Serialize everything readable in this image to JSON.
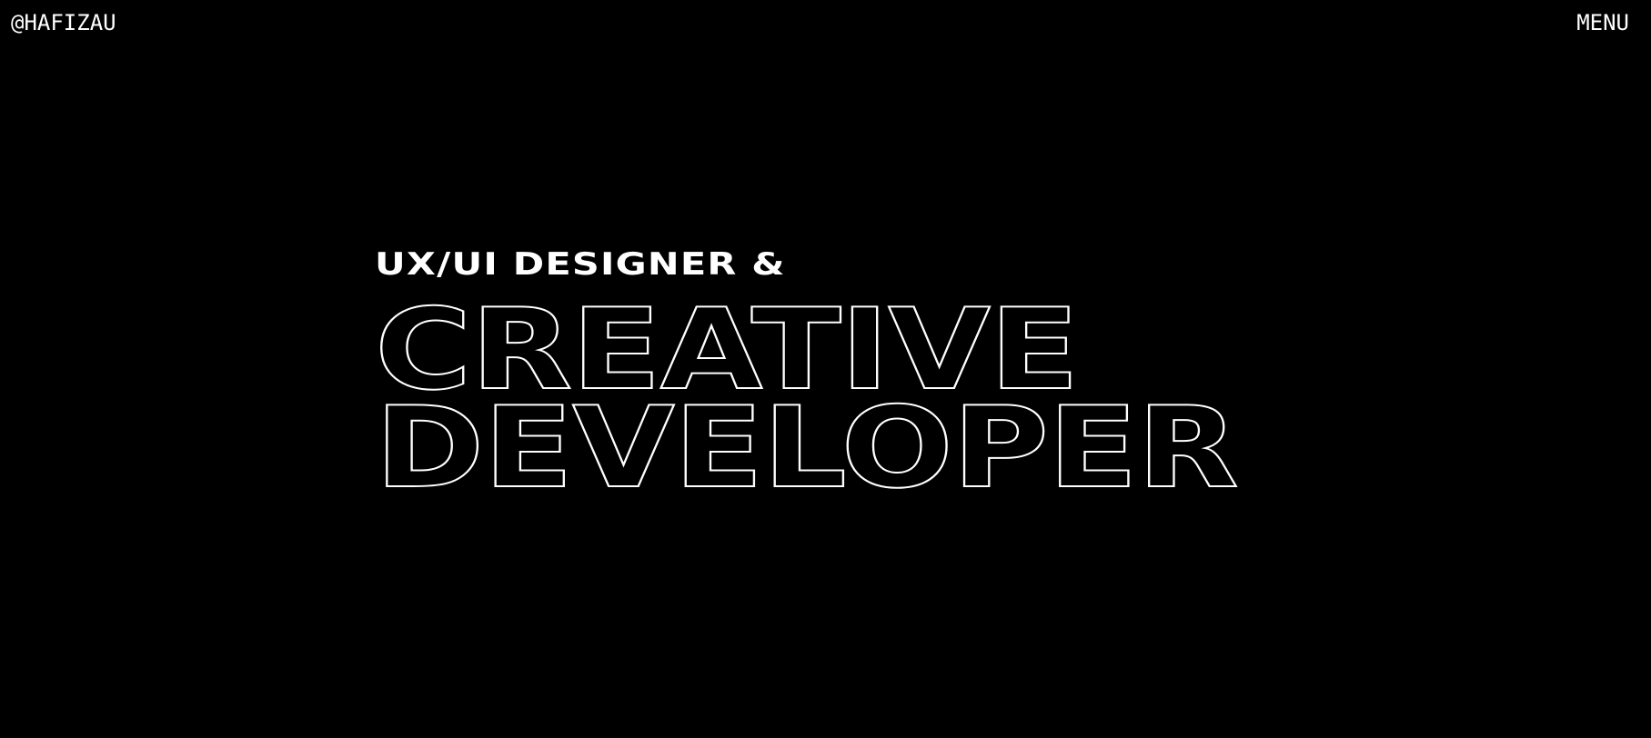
{
  "header": {
    "brand": "@HAFIZAU",
    "menu_label": "MENU"
  },
  "hero": {
    "subtitle": "UX/UI DESIGNER &",
    "title_line_1": "CREATIVE",
    "title_line_2": "DEVELOPER"
  },
  "colors": {
    "background": "#000000",
    "text": "#ffffff",
    "outline": "#ffffff"
  }
}
